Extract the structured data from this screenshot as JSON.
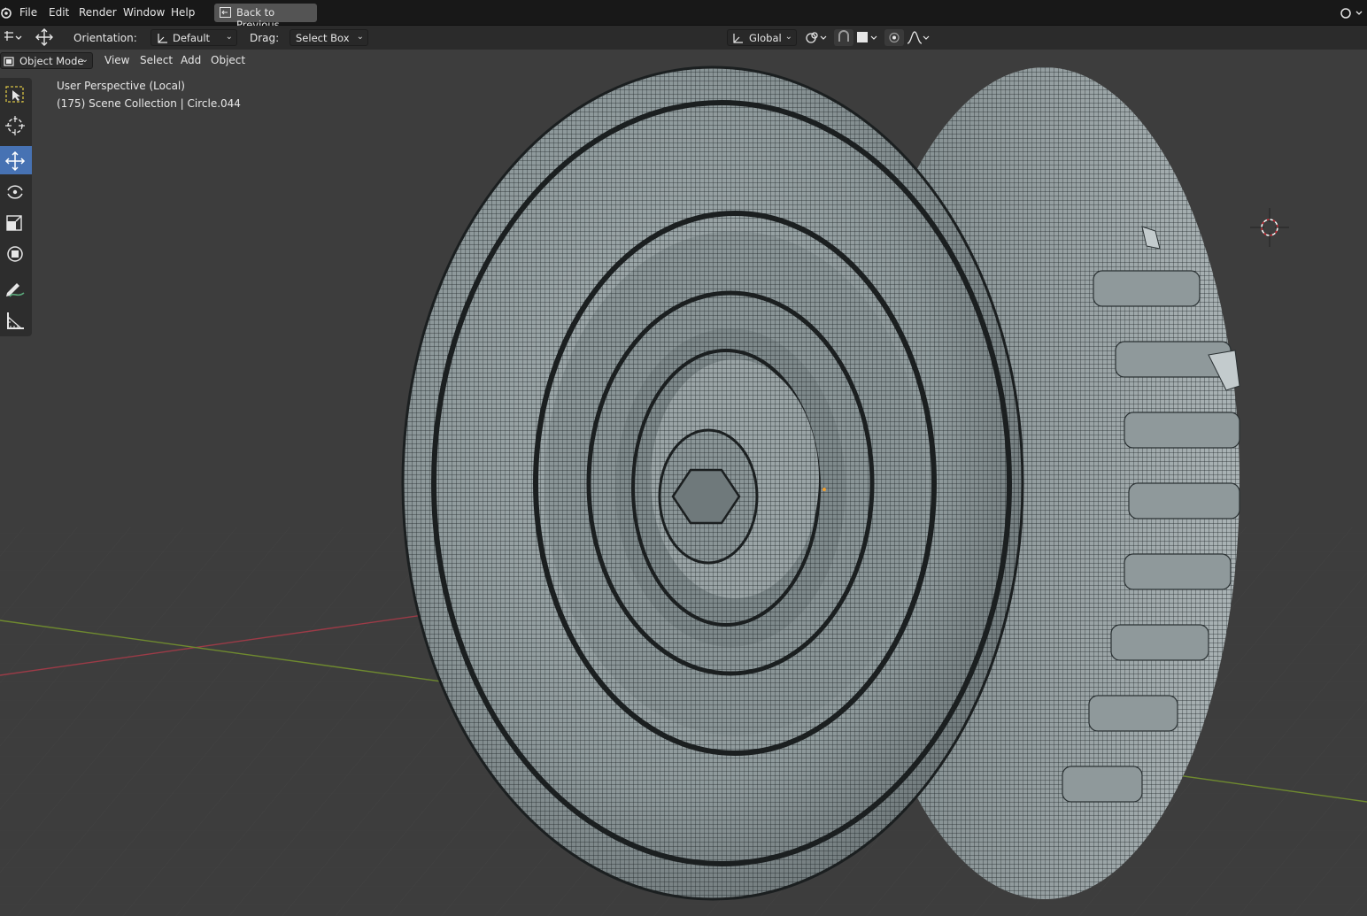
{
  "menubar": {
    "items": [
      "File",
      "Edit",
      "Render",
      "Window",
      "Help"
    ],
    "back_button": "Back to Previous"
  },
  "tool_header": {
    "orientation_label": "Orientation:",
    "orientation_value": "Default",
    "drag_label": "Drag:",
    "drag_value": "Select Box",
    "transform_orientation": "Global"
  },
  "viewport_header": {
    "mode": "Object Mode",
    "menus": [
      "View",
      "Select",
      "Add",
      "Object"
    ]
  },
  "overlay": {
    "view_name": "User Perspective (Local)",
    "collection_info": "(175) Scene Collection | Circle.044"
  },
  "toolbar": {
    "tools": [
      "select-box",
      "cursor",
      "move",
      "rotate",
      "scale",
      "transform",
      "annotate",
      "measure"
    ],
    "active": "move"
  },
  "colors": {
    "active_tool": "#4772b3",
    "x_axis": "#9c3b47",
    "y_axis": "#6f8a2f",
    "background": "#3d3d3d"
  }
}
